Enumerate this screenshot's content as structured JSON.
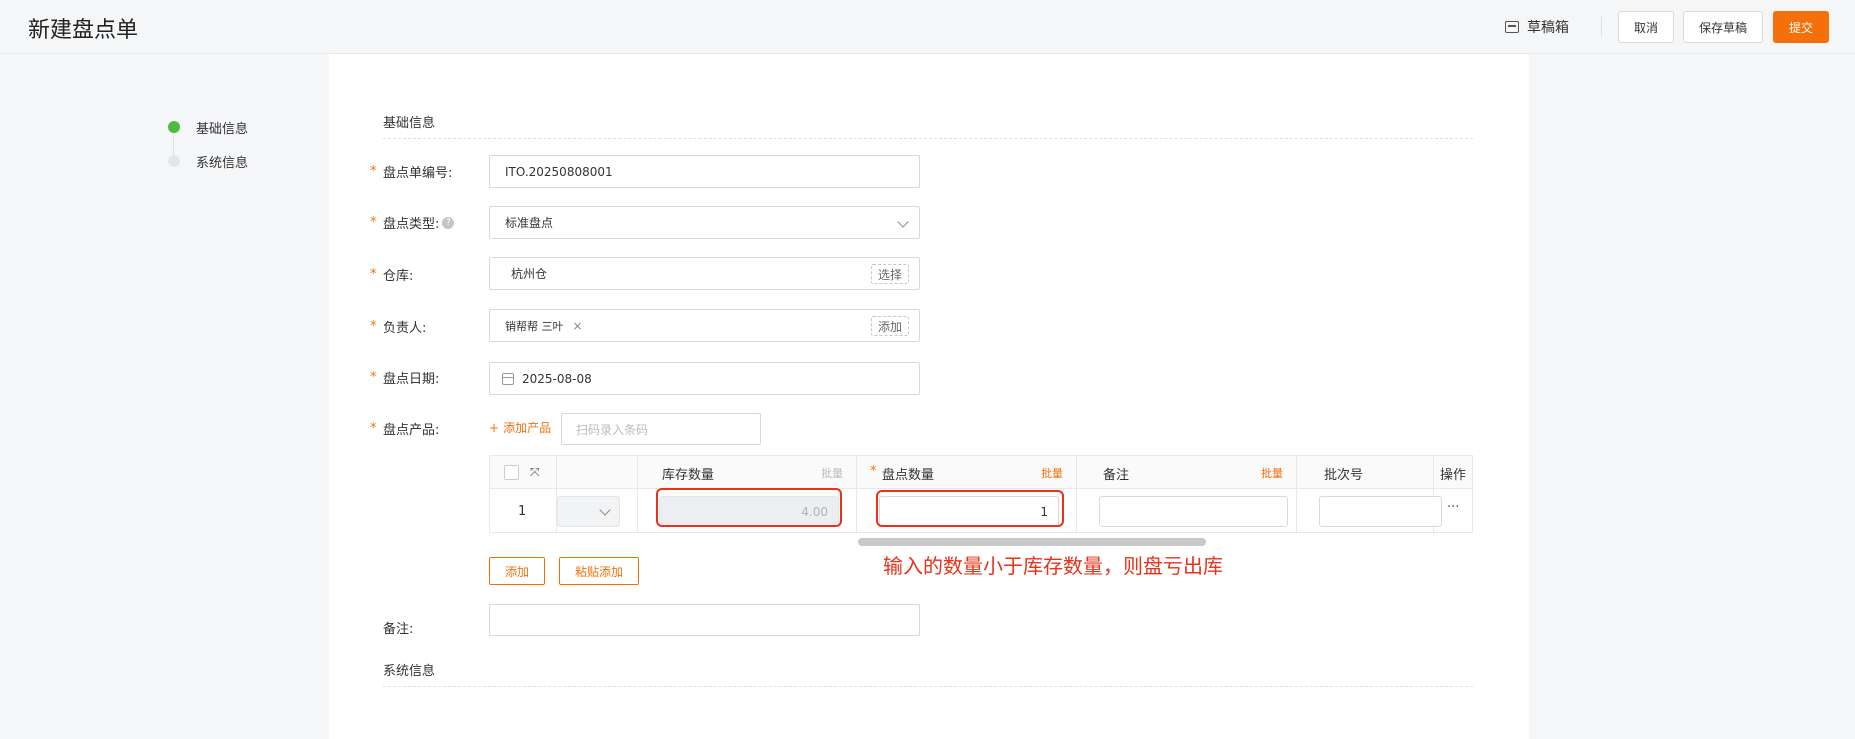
{
  "header": {
    "title": "新建盘点单",
    "drafts_label": "草稿箱",
    "cancel_label": "取消",
    "save_draft_label": "保存草稿",
    "submit_label": "提交",
    "accent_color": "#f5700a"
  },
  "steps": [
    {
      "label": "基础信息",
      "active": true
    },
    {
      "label": "系统信息",
      "active": false
    }
  ],
  "form": {
    "section_basic": "基础信息",
    "section_system": "系统信息",
    "required_mark": "*",
    "help_mark": "?",
    "number": {
      "label": "盘点单编号:",
      "value": "ITO.20250808001"
    },
    "type": {
      "label": "盘点类型:",
      "value": "标准盘点"
    },
    "warehouse": {
      "label": "仓库:",
      "value": "杭州仓",
      "button": "选择"
    },
    "owner": {
      "label": "负责人:",
      "tag": "销帮帮 三叶",
      "tag_remove": "×",
      "button": "添加"
    },
    "date": {
      "label": "盘点日期:",
      "value": "2025-08-08"
    },
    "products": {
      "label": "盘点产品:",
      "add_label": "添加产品",
      "add_icon": "+",
      "scan_placeholder": "扫码录入条码"
    },
    "remark": {
      "label": "备注:",
      "value": ""
    }
  },
  "table": {
    "columns": {
      "stock_qty": "库存数量",
      "count_qty": "盘点数量",
      "remark": "备注",
      "batch_no": "批次号",
      "action": "操作",
      "batch_label": "批量"
    },
    "expand_icon": "⤧",
    "rows": [
      {
        "index": "1",
        "stock_qty": "4.00",
        "count_qty": "1",
        "remark": "",
        "batch_no": "",
        "more": "···"
      }
    ],
    "add_label": "添加",
    "paste_add_label": "粘贴添加"
  },
  "annotation": "输入的数量小于库存数量，则盘亏出库"
}
